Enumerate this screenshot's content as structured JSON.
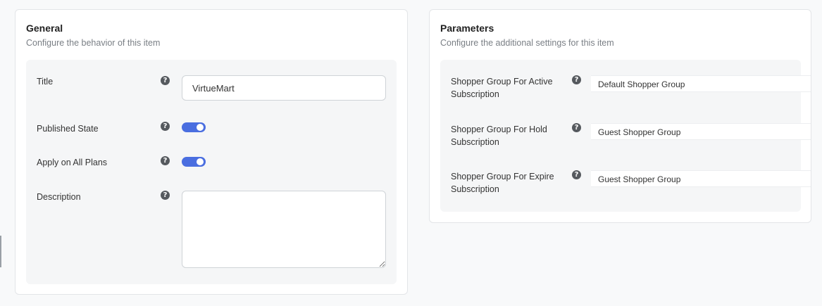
{
  "general": {
    "title": "General",
    "subtitle": "Configure the behavior of this item",
    "fields": {
      "title_label": "Title",
      "title_value": "VirtueMart",
      "published_label": "Published State",
      "published_on": true,
      "apply_label": "Apply on All Plans",
      "apply_on": true,
      "description_label": "Description",
      "description_value": ""
    }
  },
  "parameters": {
    "title": "Parameters",
    "subtitle": "Configure the additional settings for this item",
    "fields": [
      {
        "label": "Shopper Group For Active Subscription",
        "value": "Default Shopper Group"
      },
      {
        "label": "Shopper Group For Hold Subscription",
        "value": "Guest Shopper Group"
      },
      {
        "label": "Shopper Group For Expire Subscription",
        "value": "Guest Shopper Group"
      }
    ]
  },
  "help_glyph": "?",
  "colors": {
    "toggle_on": "#4a6ee0",
    "help_icon": "#55595e"
  }
}
